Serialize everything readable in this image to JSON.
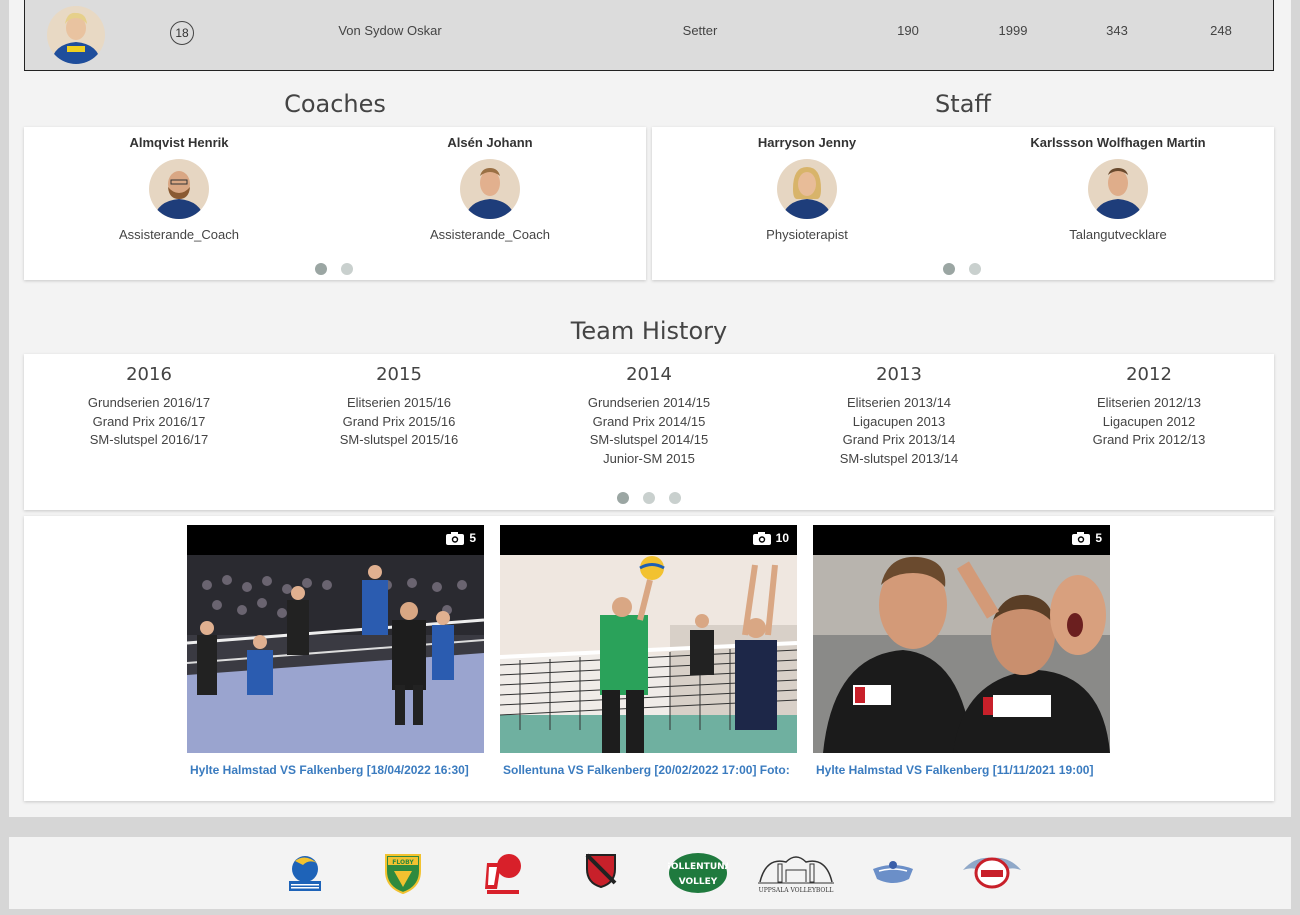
{
  "player": {
    "number": "18",
    "name": "Von Sydow Oskar",
    "position": "Setter",
    "height": "190",
    "born": "1999",
    "stat1": "343",
    "stat2": "248"
  },
  "coaches": {
    "title": "Coaches",
    "people": [
      {
        "name": "Almqvist Henrik",
        "role": "Assisterande_Coach"
      },
      {
        "name": "Alsén Johann",
        "role": "Assisterande_Coach"
      }
    ]
  },
  "staff": {
    "title": "Staff",
    "people": [
      {
        "name": "Harryson Jenny",
        "role": "Physioterapist"
      },
      {
        "name": "Karlssson Wolfhagen Martin",
        "role": "Talangutvecklare"
      }
    ]
  },
  "history": {
    "title": "Team History",
    "years": [
      {
        "year": "2016",
        "items": [
          "Grundserien 2016/17",
          "Grand Prix 2016/17",
          "SM-slutspel 2016/17"
        ]
      },
      {
        "year": "2015",
        "items": [
          "Elitserien 2015/16",
          "Grand Prix 2015/16",
          "SM-slutspel 2015/16"
        ]
      },
      {
        "year": "2014",
        "items": [
          "Grundserien 2014/15",
          "Grand Prix 2014/15",
          "SM-slutspel 2014/15",
          "Junior-SM 2015"
        ]
      },
      {
        "year": "2013",
        "items": [
          "Elitserien 2013/14",
          "Ligacupen 2013",
          "Grand Prix 2013/14",
          "SM-slutspel 2013/14"
        ]
      },
      {
        "year": "2012",
        "items": [
          "Elitserien 2012/13",
          "Ligacupen 2012",
          "Grand Prix 2012/13"
        ]
      }
    ]
  },
  "galleries": [
    {
      "count": "5",
      "title": "Hylte Halmstad VS Falkenberg [18/04/2022 16:30]"
    },
    {
      "count": "10",
      "title": "Sollentuna VS Falkenberg [20/02/2022 17:00] Foto:"
    },
    {
      "count": "5",
      "title": "Hylte Halmstad VS Falkenberg [11/11/2021 19:00]"
    }
  ],
  "logos": {
    "floby": "FLOBY",
    "sollentuna_top": "SOLLENTUNA",
    "sollentuna_bottom": "VOLLEY",
    "uppsala": "UPPSALA VOLLEYBOLL"
  },
  "colors": {
    "link": "#3a7bbf",
    "dot_active": "#9ba6a3",
    "dot": "#c9d0ce"
  }
}
